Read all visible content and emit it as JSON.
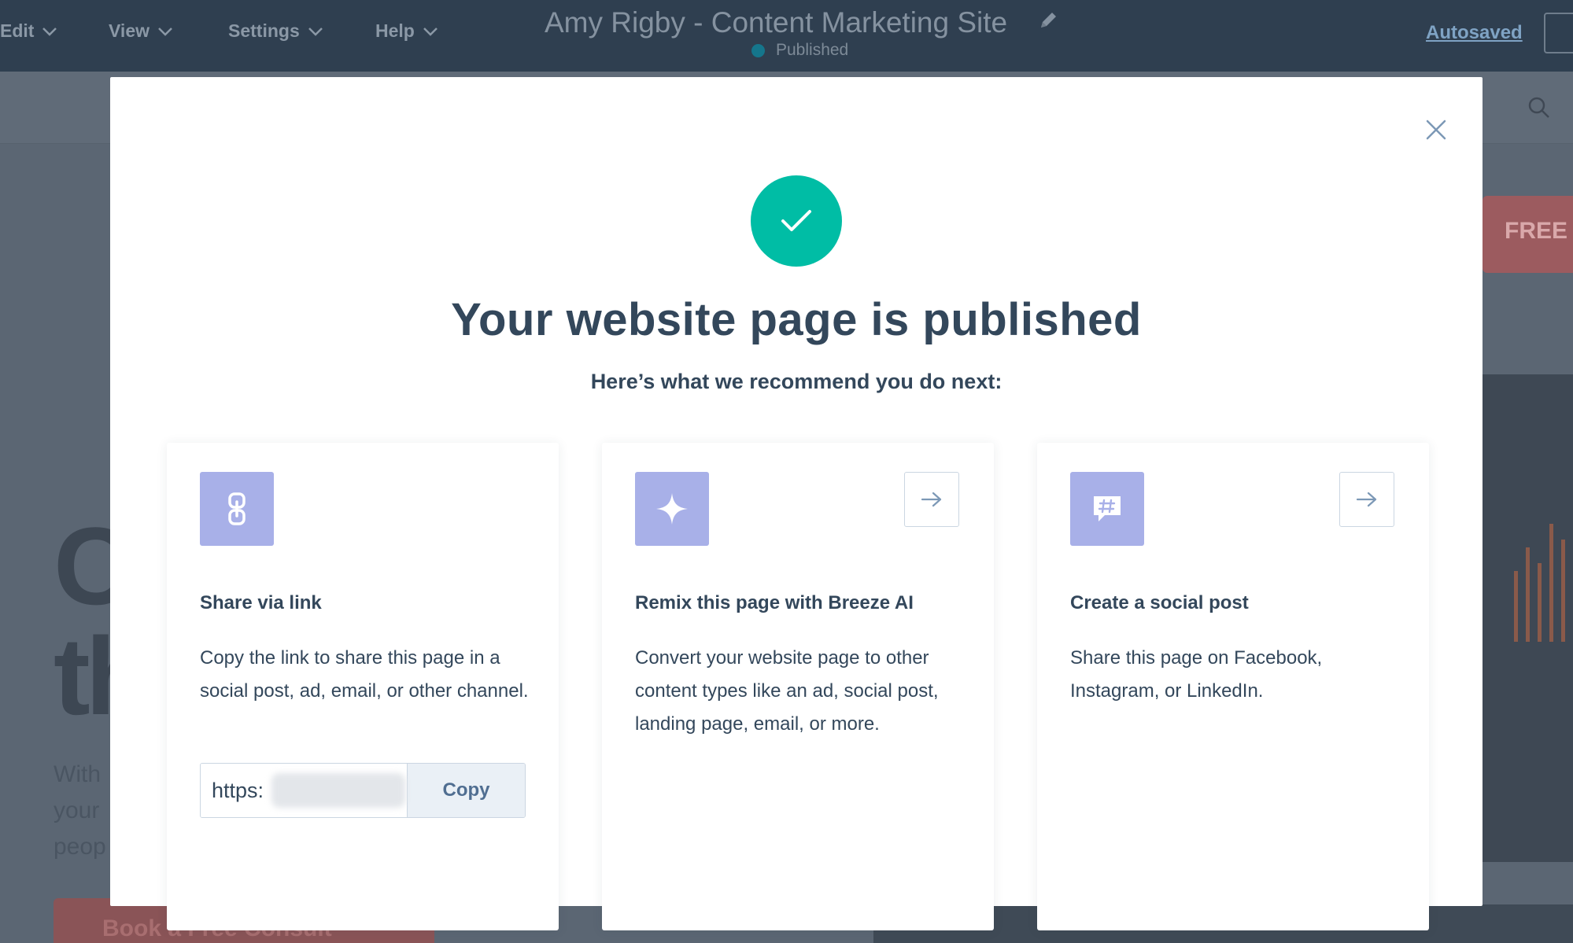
{
  "topbar": {
    "menus": [
      {
        "label": "Edit"
      },
      {
        "label": "View"
      },
      {
        "label": "Settings"
      },
      {
        "label": "Help"
      }
    ],
    "site_title": "Amy Rigby - Content Marketing Site",
    "publish_status": "Published",
    "autosaved": "Autosaved"
  },
  "background": {
    "banner_text": "FREE",
    "headline_line1": "C",
    "headline_line2": "th",
    "body_lines": [
      "With",
      "your",
      "peop"
    ],
    "cta_label": "Book a Free Consult"
  },
  "modal": {
    "title": "Your website page is published",
    "subtitle": "Here’s what we recommend you do next:",
    "cards": [
      {
        "icon": "link-icon",
        "title": "Share via link",
        "description": "Copy the link to share this page in a social post, ad, email, or other channel.",
        "link_value": "https:",
        "copy_label": "Copy"
      },
      {
        "icon": "sparkle-icon",
        "title": "Remix this page with Breeze AI",
        "description": "Convert your website page to other content types like an ad, social post, landing page, email, or more."
      },
      {
        "icon": "social-post-icon",
        "title": "Create a social post",
        "description": "Share this page on Facebook, Instagram, or LinkedIn."
      }
    ]
  },
  "colors": {
    "topbar": "#2f3f50",
    "success": "#00bda5",
    "card_icon_bg": "#a8b0e8",
    "text": "#33475b",
    "copy_button_bg": "#eaf0f6"
  }
}
